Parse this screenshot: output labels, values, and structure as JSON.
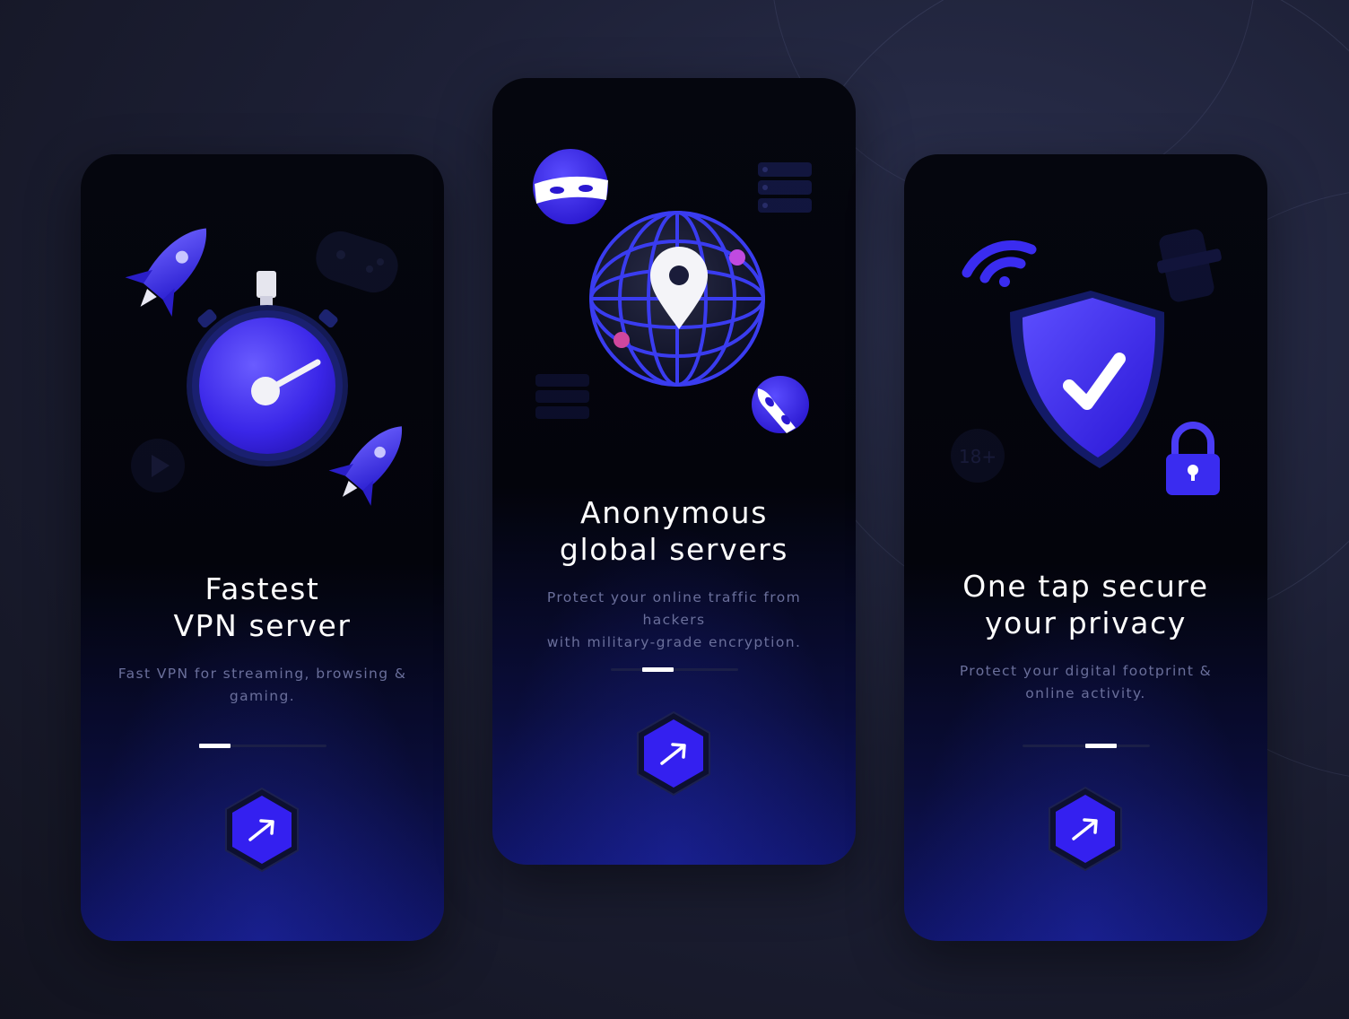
{
  "screens": [
    {
      "title": "Fastest\nVPN server",
      "subtitle": "Fast VPN for streaming, browsing &\ngaming.",
      "active_page": 1,
      "page_count": 4,
      "next_icon": "arrow-up-right-icon"
    },
    {
      "title": "Anonymous\nglobal servers",
      "subtitle": "Protect your online traffic from hackers\nwith military-grade encryption.",
      "active_page": 2,
      "page_count": 4,
      "next_icon": "arrow-up-right-icon"
    },
    {
      "title": "One tap secure\nyour privacy",
      "subtitle": "Protect your digital footprint &\nonline activity.",
      "active_page": 3,
      "page_count": 4,
      "age_badge": "18+",
      "next_icon": "arrow-up-right-icon"
    }
  ],
  "colors": {
    "accent": "#3a2cf0",
    "accent_light": "#5b4dff",
    "card_bg": "#04050c",
    "text_primary": "#ffffff",
    "text_secondary": "#6a6f9b"
  }
}
